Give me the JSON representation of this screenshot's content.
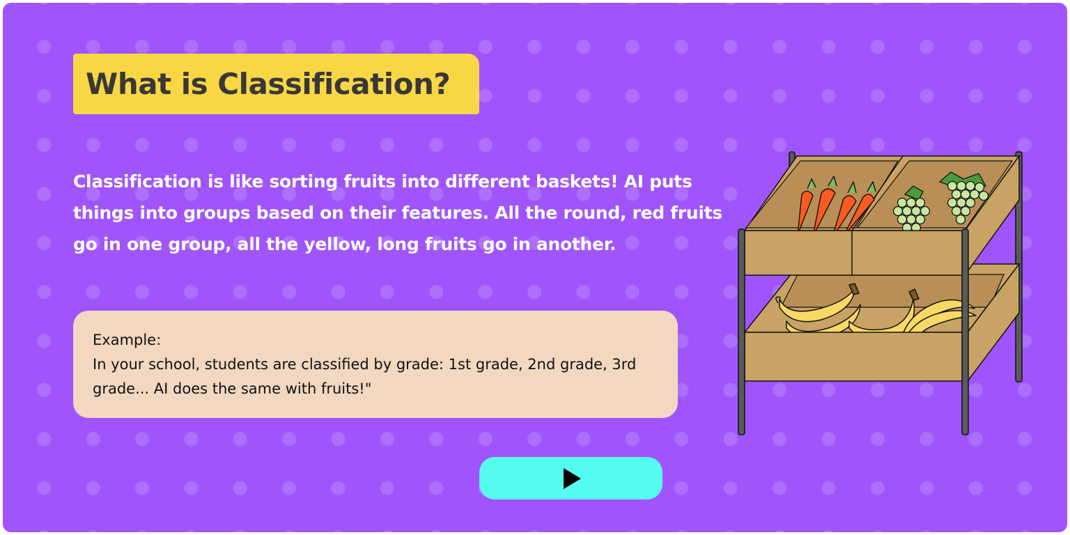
{
  "slide": {
    "title": "What is Classification?",
    "description": "Classification is like sorting fruits into different baskets! AI puts things into groups based on their features. All the round, red fruits go in one group, all the yellow, long fruits go in another.",
    "example": {
      "heading": "Example:",
      "text": "In your school, students are classified by grade: 1st grade, 2nd grade, 3rd grade... AI does the same with fruits!\""
    }
  },
  "play_button": {
    "icon": "play-icon"
  },
  "illustration": {
    "icon": "fruit-stand-illustration",
    "contents": [
      "carrots",
      "grapes",
      "bananas"
    ]
  },
  "colors": {
    "background": "#9f55fb",
    "title_bg": "#f9d744",
    "example_bg": "#f2d7c1",
    "play_button_bg": "#56fbef",
    "text_light": "#ffffff",
    "text_dark": "#383838"
  }
}
